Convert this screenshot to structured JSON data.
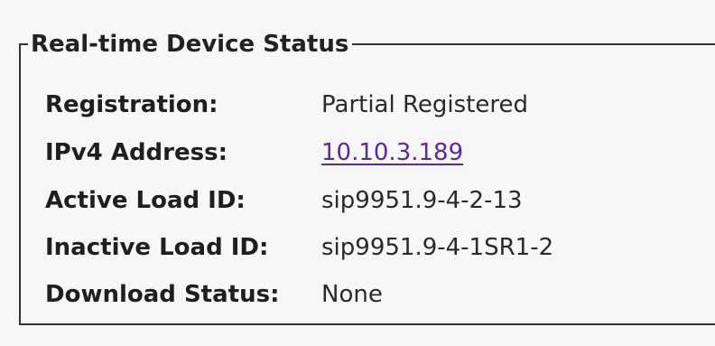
{
  "panel": {
    "title": "Real-time Device Status",
    "rows": [
      {
        "label": "Registration:",
        "value": "Partial Registered"
      },
      {
        "label": "IPv4 Address:",
        "value": "10.10.3.189"
      },
      {
        "label": "Active Load ID:",
        "value": "sip9951.9-4-2-13"
      },
      {
        "label": "Inactive Load ID:",
        "value": "sip9951.9-4-1SR1-2"
      },
      {
        "label": "Download Status:",
        "value": "None"
      }
    ]
  },
  "colors": {
    "background": "#f7f7f7",
    "border": "#333333",
    "link": "#5a2a9e"
  }
}
